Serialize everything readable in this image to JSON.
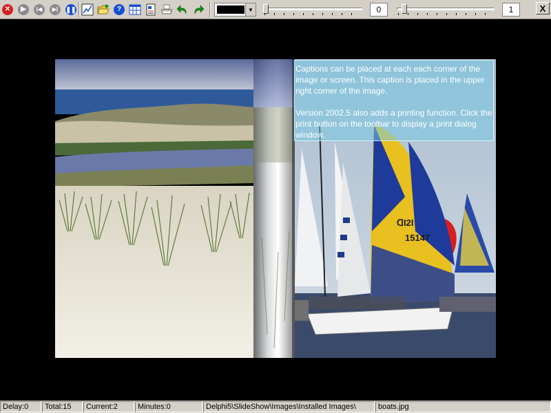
{
  "toolbar": {
    "buttons": [
      {
        "icon": "stop-icon",
        "color": "#d42020"
      },
      {
        "icon": "play-icon",
        "color": "#8a8a8a"
      },
      {
        "icon": "skip-back-icon",
        "color": "#8a8a8a"
      },
      {
        "icon": "skip-forward-icon",
        "color": "#8a8a8a"
      },
      {
        "icon": "pause-icon",
        "color": "#1a4fd0"
      },
      {
        "icon": "chart-icon",
        "color": "#1a4fd0"
      },
      {
        "icon": "folder-open-icon",
        "color": "#e0c040"
      },
      {
        "icon": "help-icon",
        "color": "#1a4fd0"
      },
      {
        "icon": "grid-icon",
        "color": "#1a4fd0"
      },
      {
        "icon": "document-icon",
        "color": "#1a4fd0"
      },
      {
        "icon": "printer-icon",
        "color": "#a0a0a0"
      },
      {
        "icon": "undo-icon",
        "color": "#1c8a1c"
      },
      {
        "icon": "redo-icon",
        "color": "#1c8a1c"
      }
    ],
    "color_value": "#000000",
    "delay_value": "0",
    "transition_value": "1",
    "delay_slider_level": 0,
    "transition_slider_level": 0.05,
    "close_label": "X"
  },
  "caption": {
    "paragraph_1": "Captions can be placed at each each corner of the image or screen. This caption is placed in the upper right corner of the image.",
    "paragraph_2": "Version 2002.5 also adds a printing function. Click the print button on the toolbar to display a print dialog window."
  },
  "status": {
    "delay": "Delay:0",
    "total": "Total:15",
    "current": "Current:2",
    "minutes": "Minutes:0",
    "path": "Delphi5\\SlideShow\\Images\\Installed Images\\",
    "file": "boats.jpg"
  }
}
